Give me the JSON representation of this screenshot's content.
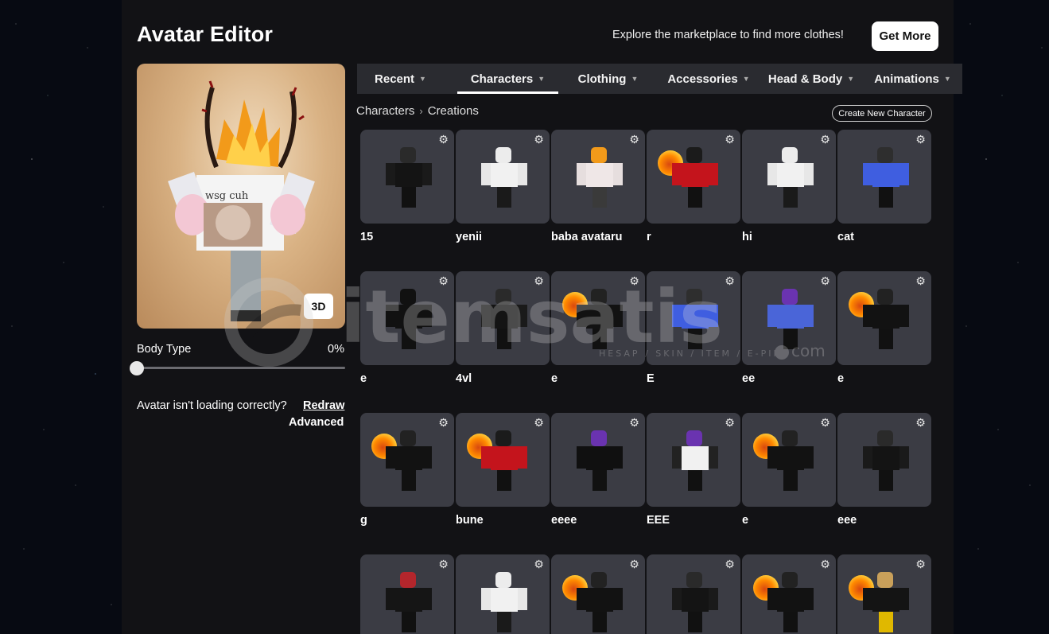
{
  "header": {
    "title": "Avatar Editor",
    "promo_text": "Explore the marketplace to find more clothes!",
    "get_more_label": "Get More"
  },
  "preview": {
    "view_toggle_label": "3D",
    "body_type_label": "Body Type",
    "body_type_value": "0%",
    "body_type_fraction": 0,
    "loading_prompt": "Avatar isn't loading correctly?",
    "redraw_label": "Redraw",
    "advanced_label": "Advanced"
  },
  "tabs": [
    {
      "label": "Recent",
      "active": false
    },
    {
      "label": "Characters",
      "active": true
    },
    {
      "label": "Clothing",
      "active": false
    },
    {
      "label": "Accessories",
      "active": false
    },
    {
      "label": "Head & Body",
      "active": false
    },
    {
      "label": "Animations",
      "active": false
    }
  ],
  "breadcrumb": {
    "root": "Characters",
    "current": "Creations"
  },
  "create_character_label": "Create New Character",
  "characters": [
    {
      "name": "15",
      "outfit": "black"
    },
    {
      "name": "yenii",
      "outfit": "white"
    },
    {
      "name": "baba avataru",
      "outfit": "white-horns"
    },
    {
      "name": "r",
      "outfit": "red-fire"
    },
    {
      "name": "hi",
      "outfit": "white"
    },
    {
      "name": "cat",
      "outfit": "blue"
    },
    {
      "name": "e",
      "outfit": "black-dog"
    },
    {
      "name": "4vl",
      "outfit": "black"
    },
    {
      "name": "e",
      "outfit": "black-fire"
    },
    {
      "name": "E",
      "outfit": "blue"
    },
    {
      "name": "ee",
      "outfit": "blue-purple"
    },
    {
      "name": "e",
      "outfit": "black-fire"
    },
    {
      "name": "g",
      "outfit": "black-fire"
    },
    {
      "name": "bune",
      "outfit": "red-fire"
    },
    {
      "name": "eeee",
      "outfit": "black-purple"
    },
    {
      "name": "EEE",
      "outfit": "white-purple"
    },
    {
      "name": "e",
      "outfit": "black-fire"
    },
    {
      "name": "eee",
      "outfit": "black"
    },
    {
      "name": "",
      "outfit": "red-hair"
    },
    {
      "name": "",
      "outfit": "white"
    },
    {
      "name": "",
      "outfit": "black-fire"
    },
    {
      "name": "",
      "outfit": "black"
    },
    {
      "name": "",
      "outfit": "black-fire"
    },
    {
      "name": "",
      "outfit": "yellow-fire"
    }
  ],
  "watermark": {
    "brand": "itemsatis",
    "tagline": "HESAP / SKIN / ITEM / E-PIN",
    "suffix": ".com"
  },
  "colors": {
    "panel": "#121215",
    "tab_bar": "#2a2b30",
    "card": "#3b3c44",
    "accent_button": "#ffffff"
  }
}
